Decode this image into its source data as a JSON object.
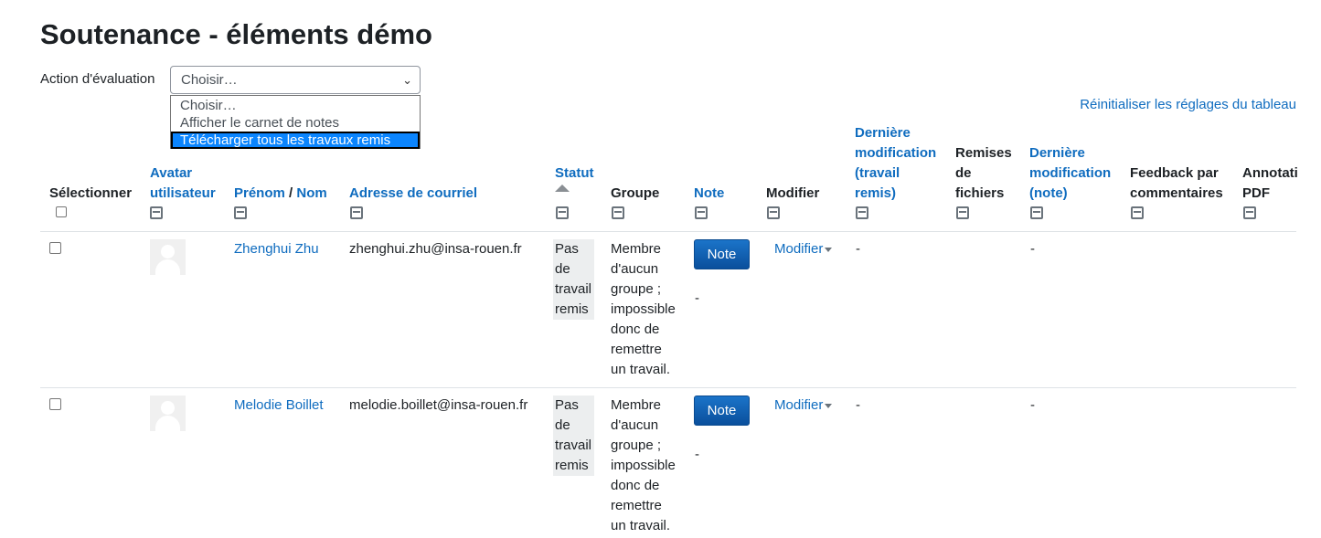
{
  "page": {
    "title": "Soutenance - éléments démo",
    "action_label": "Action d'évaluation",
    "select_value": "Choisir…",
    "dropdown_options": [
      "Choisir…",
      "Afficher le carnet de notes",
      "Télécharger tous les travaux remis"
    ],
    "selected_option_index": 2,
    "reset_link": "Réinitialiser les réglages du tableau"
  },
  "table": {
    "headers": {
      "select": "Sélectionner",
      "avatar": [
        "Avatar",
        "utilisateur"
      ],
      "firstname": "Prénom",
      "separator": "/",
      "lastname": "Nom",
      "email": "Adresse de courriel",
      "status": "Statut",
      "group": "Groupe",
      "grade": "Note",
      "edit": "Modifier",
      "last_modified_submission": [
        "Dernière",
        "modification",
        "(travail",
        "remis)"
      ],
      "file_submissions": [
        "Remises",
        "de",
        "fichiers"
      ],
      "last_modified_grade": [
        "Dernière",
        "modification",
        "(note)"
      ],
      "feedback": [
        "Feedback par",
        "commentaires"
      ],
      "annotation": [
        "Annotati",
        "PDF"
      ]
    },
    "rows": [
      {
        "name": "Zhenghui Zhu",
        "email": "zhenghui.zhu@insa-rouen.fr",
        "status": [
          "Pas",
          "de",
          "travail",
          "remis"
        ],
        "group": [
          "Membre",
          "d'aucun",
          "groupe ;",
          "impossible",
          "donc de",
          "remettre",
          "un travail."
        ],
        "grade_button": "Note",
        "grade_value": "-",
        "modify": "Modifier",
        "last_modified_submission": "-",
        "last_modified_grade": "-"
      },
      {
        "name": "Melodie Boillet",
        "email": "melodie.boillet@insa-rouen.fr",
        "status": [
          "Pas",
          "de",
          "travail",
          "remis"
        ],
        "group": [
          "Membre",
          "d'aucun",
          "groupe ;",
          "impossible",
          "donc de",
          "remettre",
          "un travail."
        ],
        "grade_button": "Note",
        "grade_value": "-",
        "modify": "Modifier",
        "last_modified_submission": "-",
        "last_modified_grade": "-"
      }
    ]
  },
  "colors": {
    "link": "#0f6cbf",
    "highlight": "#0b85ff",
    "status_bg": "#eceeef",
    "button": "#0f6cbf"
  }
}
